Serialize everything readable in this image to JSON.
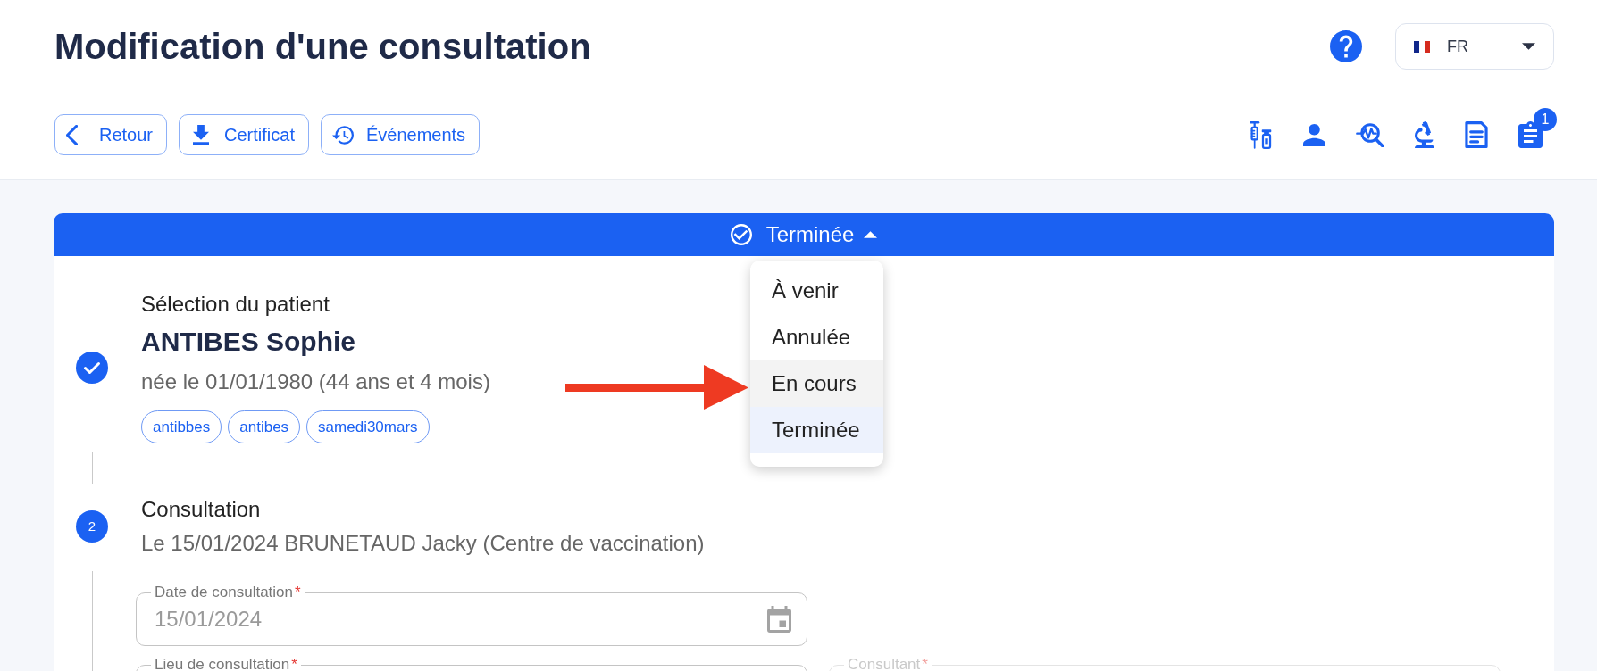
{
  "header": {
    "title": "Modification d'une consultation",
    "language": {
      "code": "FR"
    }
  },
  "actions": [
    {
      "kind": "back",
      "label": "Retour"
    },
    {
      "kind": "download",
      "label": "Certificat"
    },
    {
      "kind": "history",
      "label": "Événements"
    }
  ],
  "toolbar": [
    {
      "kind": "syringe"
    },
    {
      "kind": "person"
    },
    {
      "kind": "pulse-search"
    },
    {
      "kind": "microscope"
    },
    {
      "kind": "document"
    },
    {
      "kind": "clipboard",
      "badge": "1"
    }
  ],
  "status": {
    "label": "Terminée",
    "expanded": true,
    "options": [
      {
        "label": "À venir",
        "selected": false,
        "hovered": false
      },
      {
        "label": "Annulée",
        "selected": false,
        "hovered": false
      },
      {
        "label": "En cours",
        "selected": false,
        "hovered": true
      },
      {
        "label": "Terminée",
        "selected": true,
        "hovered": false
      }
    ]
  },
  "annotations": [
    {
      "kind": "arrow"
    }
  ],
  "steps": [
    {
      "completed": true,
      "title": "Sélection du patient",
      "patient_name": "ANTIBES Sophie",
      "details": "née le 01/01/1980 (44 ans et 4 mois)",
      "tags": [
        "antibbes",
        "antibes",
        "samedi30mars"
      ]
    },
    {
      "completed": false,
      "number": "2",
      "title": "Consultation",
      "details": "Le 15/01/2024 BRUNETAUD Jacky (Centre de vaccination)",
      "field_rows": [
        {
          "fields": [
            {
              "kind": "date",
              "label": "Date de consultation",
              "required_mark": "*",
              "value": "15/01/2024",
              "disabled": false
            }
          ]
        },
        {
          "fields": [
            {
              "kind": "text",
              "label": "Lieu de consultation",
              "required_mark": "*",
              "disabled": false
            },
            {
              "kind": "text",
              "label": "Consultant",
              "required_mark": "*",
              "disabled": true
            }
          ]
        }
      ]
    }
  ]
}
